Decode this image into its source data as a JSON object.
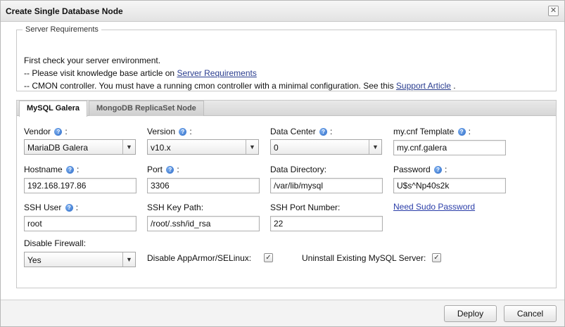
{
  "dialog": {
    "title": "Create Single Database Node",
    "close_glyph": "✕"
  },
  "requirements": {
    "legend": "Server Requirements",
    "line1": "First check your server environment.",
    "line2_prefix": "-- Please visit knowledge base article on ",
    "line2_link": "Server Requirements",
    "line3_prefix": "-- CMON controller. You must have a running cmon controller with a minimal configuration. See this ",
    "line3_link": "Support Article",
    "line3_suffix": " ."
  },
  "tabs": [
    {
      "label": "MySQL Galera",
      "active": true
    },
    {
      "label": "MongoDB ReplicaSet Node",
      "active": false
    }
  ],
  "form": {
    "vendor": {
      "label": "Vendor",
      "value": "MariaDB Galera"
    },
    "version": {
      "label": "Version",
      "value": "v10.x"
    },
    "data_center": {
      "label": "Data Center",
      "value": "0"
    },
    "mycnf_template": {
      "label": "my.cnf Template",
      "value": "my.cnf.galera"
    },
    "hostname": {
      "label": "Hostname",
      "value": "192.168.197.86"
    },
    "port": {
      "label": "Port",
      "value": "3306"
    },
    "data_directory": {
      "label": "Data Directory:",
      "value": "/var/lib/mysql"
    },
    "password": {
      "label": "Password",
      "value": "U$s^Np40s2k"
    },
    "ssh_user": {
      "label": "SSH User",
      "value": "root"
    },
    "ssh_key_path": {
      "label": "SSH Key Path:",
      "value": "/root/.ssh/id_rsa"
    },
    "ssh_port": {
      "label": "SSH Port Number:",
      "value": "22"
    },
    "need_sudo_link": "Need Sudo Password",
    "disable_firewall": {
      "label": "Disable Firewall:",
      "value": "Yes"
    },
    "disable_apparmor": {
      "label": "Disable AppArmor/SELinux:",
      "checked": true
    },
    "uninstall_mysql": {
      "label": "Uninstall Existing MySQL Server:",
      "checked": true
    }
  },
  "icons": {
    "help": "help-icon",
    "dropdown": "chevron-down-icon",
    "check": "checkmark-icon"
  },
  "glyphs": {
    "help": "?",
    "colon": ":",
    "arrow": "▼",
    "check": "✓"
  },
  "footer": {
    "deploy_label": "Deploy",
    "cancel_label": "Cancel"
  },
  "colors": {
    "link": "#2a3da8",
    "help_icon": "#2d6cc8"
  }
}
